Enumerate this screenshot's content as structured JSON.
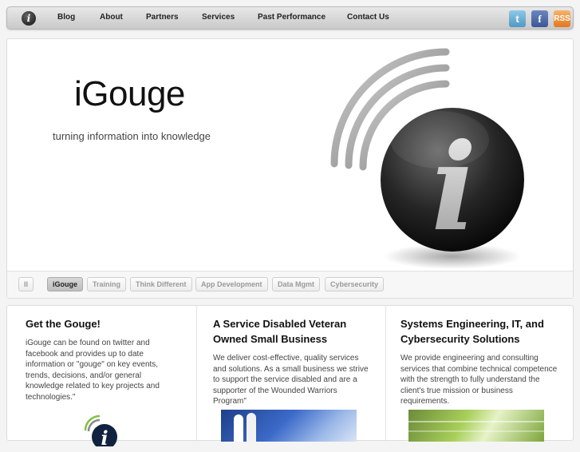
{
  "nav": {
    "logo_glyph": "i",
    "items": [
      "Blog",
      "About",
      "Partners",
      "Services",
      "Past Performance",
      "Contact Us"
    ],
    "social": [
      {
        "name": "twitter-icon",
        "glyph": "t"
      },
      {
        "name": "facebook-icon",
        "glyph": "f"
      },
      {
        "name": "rss-icon",
        "glyph": "RSS"
      }
    ]
  },
  "hero": {
    "title": "iGouge",
    "tagline": "turning information into knowledge",
    "logo_glyph": "i"
  },
  "slider": {
    "pause_glyph": "II",
    "tabs": [
      "iGouge",
      "Training",
      "Think Different",
      "App Development",
      "Data Mgmt",
      "Cybersecurity"
    ],
    "active_index": 0
  },
  "columns": [
    {
      "title": "Get the Gouge!",
      "body": "iGouge can be found on twitter and facebook and provides up to date information or \"gouge\" on key events, trends, decisions, and/or general knowledge related to key projects and technologies.\""
    },
    {
      "title": "A Service Disabled Veteran Owned Small Business",
      "body": "We deliver cost-effective, quality services and solutions. As a small business we strive to support the service disabled and are a supporter of the Wounded Warriors Program\""
    },
    {
      "title": "Systems Engineering, IT, and Cybersecurity Solutions",
      "body": "We provide engineering and consulting services that combine technical competence with the strength to fully understand the client's true mission or business requirements."
    }
  ]
}
